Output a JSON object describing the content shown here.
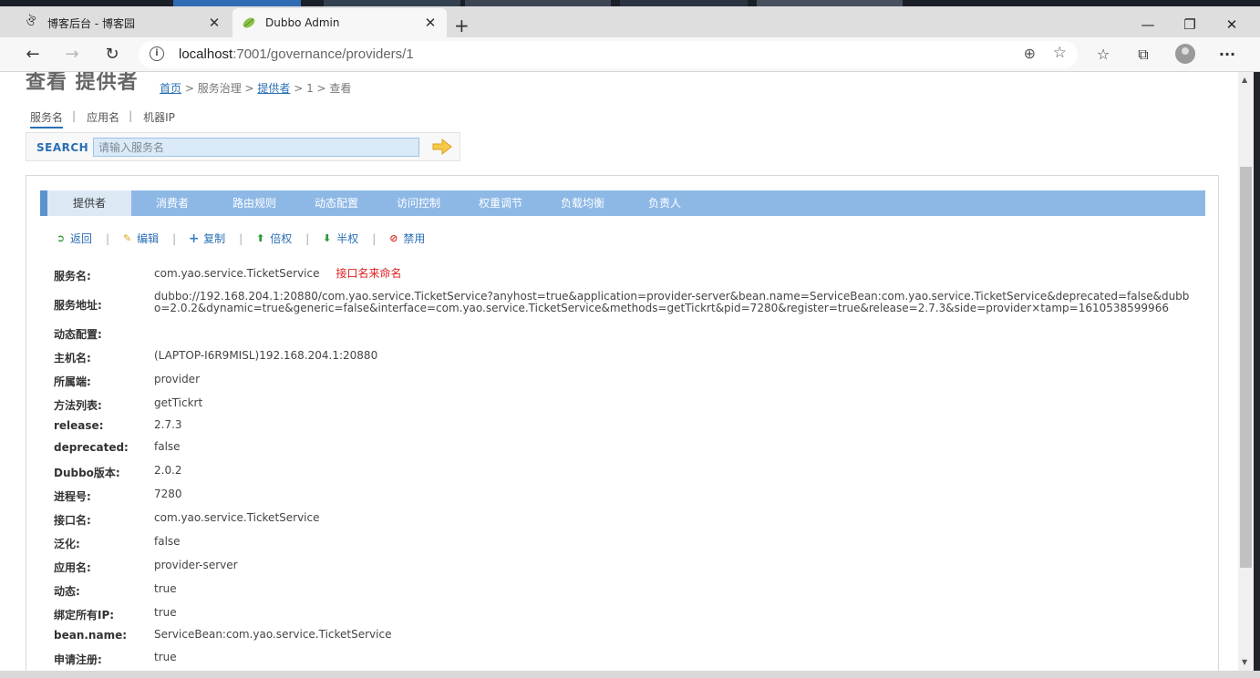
{
  "browser": {
    "tabs": [
      {
        "title": "博客后台 - 博客园",
        "active": false
      },
      {
        "title": "Dubbo Admin",
        "active": true
      }
    ],
    "url_host": "localhost",
    "url_rest": ":7001/governance/providers/1"
  },
  "page": {
    "title": "查看 提供者",
    "breadcrumb": {
      "home": "首页",
      "sep1": " > ",
      "governance": "服务治理",
      "sep2": " > ",
      "providers": "提供者",
      "tail": " > 1 > 查看"
    },
    "search_tabs": [
      "服务名",
      "应用名",
      "机器IP"
    ],
    "search": {
      "label": "SEARCH",
      "placeholder": "请输入服务名"
    },
    "menu": [
      "提供者",
      "消费者",
      "路由规则",
      "动态配置",
      "访问控制",
      "权重调节",
      "负载均衡",
      "负责人"
    ],
    "actions": [
      {
        "label": "返回",
        "icon": "return-arrow-icon"
      },
      {
        "label": "编辑",
        "icon": "pencil-icon"
      },
      {
        "label": "复制",
        "icon": "plus-icon"
      },
      {
        "label": "倍权",
        "icon": "arrow-up-icon"
      },
      {
        "label": "半权",
        "icon": "arrow-down-icon"
      },
      {
        "label": "禁用",
        "icon": "forbidden-icon"
      }
    ],
    "details": [
      {
        "key": "服务名:",
        "value": "com.yao.service.TicketService",
        "note": "接口名来命名"
      },
      {
        "key": "服务地址:",
        "value": "dubbo://192.168.204.1:20880/com.yao.service.TicketService?anyhost=true&application=provider-server&bean.name=ServiceBean:com.yao.service.TicketService&deprecated=false&dubbo=2.0.2&dynamic=true&generic=false&interface=com.yao.service.TicketService&methods=getTickrt&pid=7280&register=true&release=2.7.3&side=provider×tamp=1610538599966"
      },
      {
        "key": "动态配置:",
        "value": ""
      },
      {
        "key": "主机名:",
        "value": "(LAPTOP-I6R9MISL)192.168.204.1:20880"
      },
      {
        "key": "所属端:",
        "value": "provider"
      },
      {
        "key": "方法列表:",
        "value": "getTickrt"
      },
      {
        "key": "release:",
        "value": "2.7.3"
      },
      {
        "key": "deprecated:",
        "value": "false"
      },
      {
        "key": "Dubbo版本:",
        "value": "2.0.2"
      },
      {
        "key": "进程号:",
        "value": "7280"
      },
      {
        "key": "接口名:",
        "value": "com.yao.service.TicketService"
      },
      {
        "key": "泛化:",
        "value": "false"
      },
      {
        "key": "应用名:",
        "value": "provider-server"
      },
      {
        "key": "动态:",
        "value": "true"
      },
      {
        "key": "绑定所有IP:",
        "value": "true"
      },
      {
        "key": "bean.name:",
        "value": "ServiceBean:com.yao.service.TicketService"
      },
      {
        "key": "申请注册:",
        "value": "true"
      }
    ]
  },
  "colors": {
    "link": "#2a6fb5",
    "menu_bg": "#8db8e6",
    "note_red": "#e02020"
  }
}
